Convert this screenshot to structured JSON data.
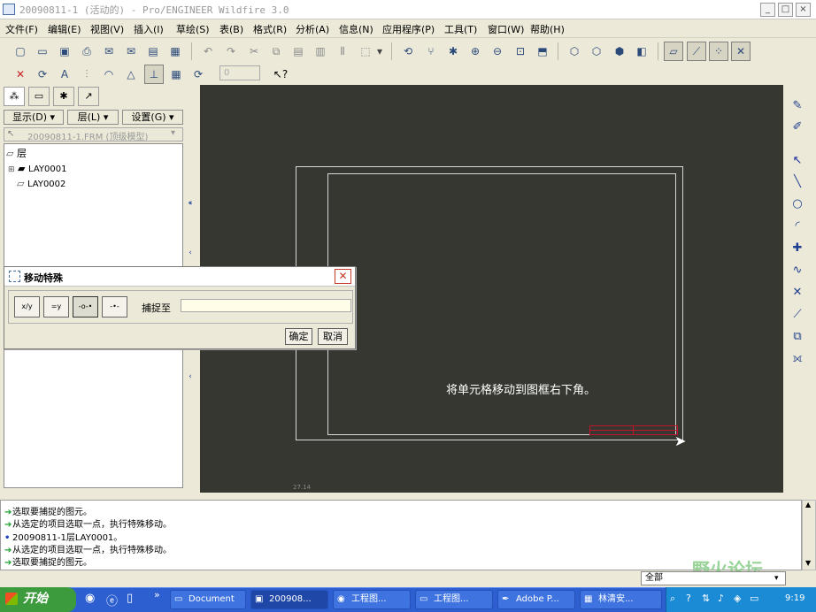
{
  "window": {
    "title": "20090811-1 (活动的) - Pro/ENGINEER Wildfire 3.0",
    "controls": {
      "minimize": "_",
      "restore": "□",
      "close": "×"
    }
  },
  "menu": [
    "文件(F)",
    "编辑(E)",
    "视图(V)",
    "插入(I)",
    "草绘(S)",
    "表(B)",
    "格式(R)",
    "分析(A)",
    "信息(N)",
    "应用程序(P)",
    "工具(T)",
    "窗口(W)",
    "帮助(H)"
  ],
  "toolbar": {
    "number_field": "0"
  },
  "left_panel": {
    "dropdowns": {
      "show": "显示(D) ▾",
      "layer": "层(L) ▾",
      "settings": "设置(G) ▾"
    },
    "model_selector": "20090811-1.FRM (顶级模型)",
    "tree": {
      "root": "层",
      "items": [
        "LAY0001",
        "LAY0002"
      ]
    }
  },
  "dialog": {
    "title": "移动特殊",
    "snap_label": "捕捉至",
    "snap_value": "",
    "ok": "确定",
    "cancel": "取消",
    "mode_icons": [
      "x/y",
      "=y",
      "-o-•",
      "-•-"
    ]
  },
  "graphics": {
    "annotation": "将单元格移动到图框右下角。",
    "corner_text": "27.14"
  },
  "messages": [
    {
      "icon": "arrow",
      "text": "选取要捕捉的图元。"
    },
    {
      "icon": "arrow",
      "text": "从选定的项目选取一点，执行特殊移动。"
    },
    {
      "icon": "dot",
      "text": "20090811-1层LAY0001。"
    },
    {
      "icon": "arrow",
      "text": "从选定的项目选取一点，执行特殊移动。"
    },
    {
      "icon": "arrow",
      "text": "选取要捕捉的图元。"
    }
  ],
  "status": {
    "filter": "全部",
    "watermark": "野火论坛"
  },
  "taskbar": {
    "start": "开始",
    "more": "»",
    "tasks": [
      "Document",
      "200908...",
      "工程图...",
      "工程图...",
      "Adobe P...",
      "林清安..."
    ],
    "clock": "9:19"
  },
  "colors": {
    "graphics_bg": "#373731",
    "frame": "#d8d8d8",
    "selected_cell": "#c0152a",
    "taskbar": "#2d5fd1",
    "start": "#3c9b3c",
    "msg_arrow": "#1e9e2e"
  }
}
